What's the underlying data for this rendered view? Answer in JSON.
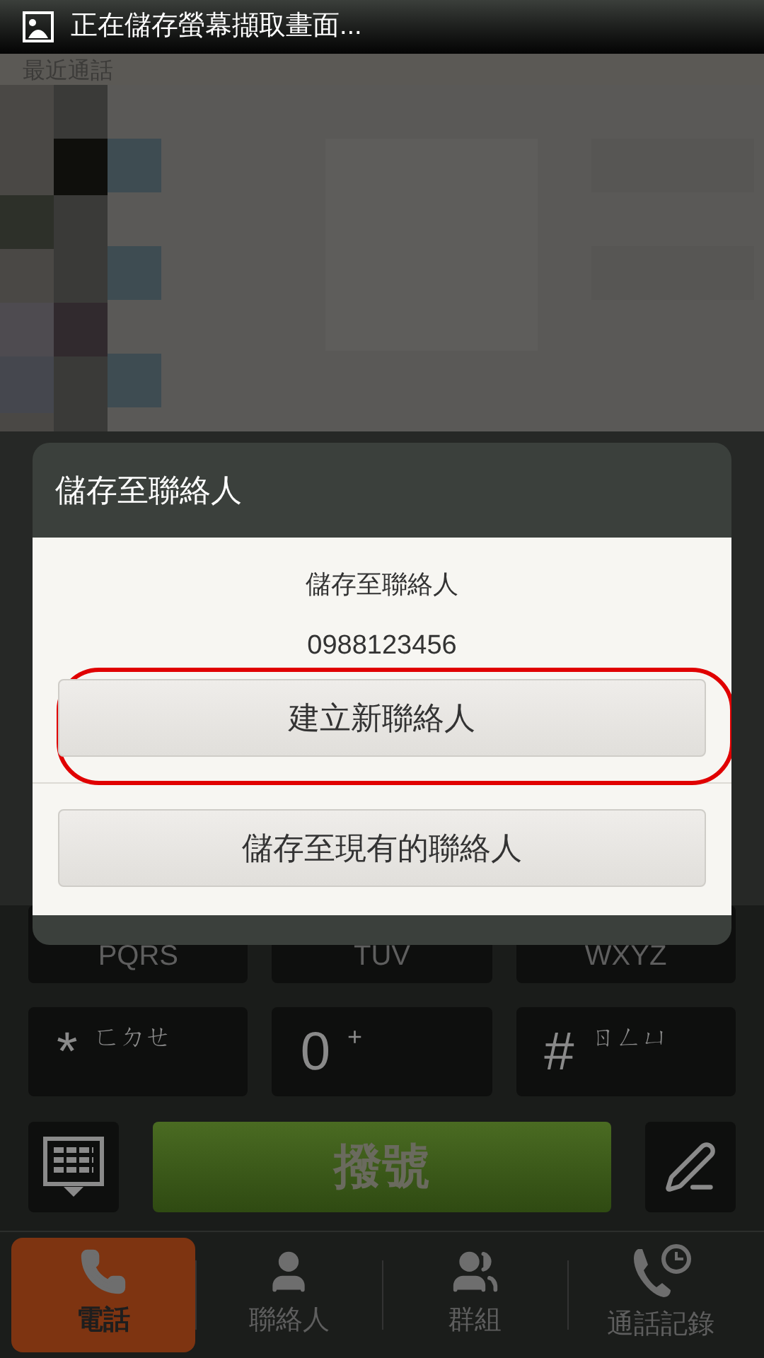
{
  "status_bar": {
    "notification": "正在儲存螢幕擷取畫面..."
  },
  "recent_calls": {
    "title": "最近通話"
  },
  "keypad": {
    "partial_keys": [
      "PQRS",
      "TUV",
      "WXYZ"
    ],
    "keys": [
      {
        "symbol": "*",
        "letters": "ㄈㄉㄝ"
      },
      {
        "symbol": "0",
        "letters": "+"
      },
      {
        "symbol": "#",
        "letters": "ㄖㄥㄩ"
      }
    ],
    "dial_button": "撥號"
  },
  "dialog": {
    "title": "儲存至聯絡人",
    "message": "儲存至聯絡人",
    "number": "0988123456",
    "buttons": [
      {
        "label": "建立新聯絡人",
        "highlighted": true
      },
      {
        "label": "儲存至現有的聯絡人",
        "highlighted": false
      }
    ]
  },
  "nav": [
    {
      "label": "電話",
      "kind": "phone",
      "selected": true
    },
    {
      "label": "聯絡人",
      "kind": "person",
      "selected": false
    },
    {
      "label": "群組",
      "kind": "group",
      "selected": false
    },
    {
      "label": "通話記錄",
      "kind": "history",
      "selected": false
    }
  ]
}
